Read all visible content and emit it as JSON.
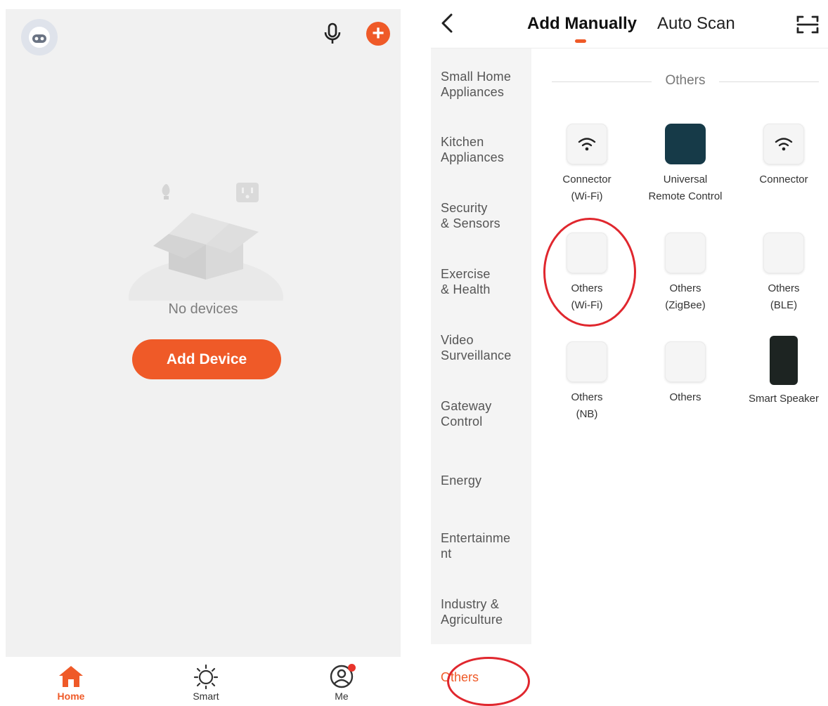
{
  "left": {
    "empty_text": "No devices",
    "add_button": "Add Device",
    "tabs": [
      {
        "label": "Home",
        "icon": "home-icon",
        "active": true
      },
      {
        "label": "Smart",
        "icon": "sun-icon",
        "active": false
      },
      {
        "label": "Me",
        "icon": "profile-icon",
        "active": false
      }
    ],
    "accent": "#ef5a28"
  },
  "right": {
    "tabs": {
      "manual": "Add Manually",
      "scan": "Auto Scan"
    },
    "categories": [
      "Small Home\nAppliances",
      "Kitchen\nAppliances",
      "Security\n& Sensors",
      "Exercise\n& Health",
      "Video\nSurveillance",
      "Gateway\nControl",
      "Energy",
      "Entertainme\nnt",
      "Industry &\nAgriculture"
    ],
    "active_category": "Others",
    "section_title": "Others",
    "devices": [
      {
        "line1": "Connector",
        "line2": "(Wi-Fi)",
        "icon": "wifi-icon"
      },
      {
        "line1": "Universal",
        "line2": "Remote Control",
        "icon": "remote-icon"
      },
      {
        "line1": "Connector",
        "line2": "",
        "icon": "wifi-icon"
      },
      {
        "line1": "Others",
        "line2": "(Wi-Fi)",
        "icon": "blank-device-icon"
      },
      {
        "line1": "Others",
        "line2": "(ZigBee)",
        "icon": "blank-device-icon"
      },
      {
        "line1": "Others",
        "line2": "(BLE)",
        "icon": "blank-device-icon"
      },
      {
        "line1": "Others",
        "line2": "(NB)",
        "icon": "blank-device-icon"
      },
      {
        "line1": "Others",
        "line2": "",
        "icon": "blank-device-icon"
      },
      {
        "line1": "Smart Speaker",
        "line2": "",
        "icon": "speaker-icon"
      }
    ]
  }
}
